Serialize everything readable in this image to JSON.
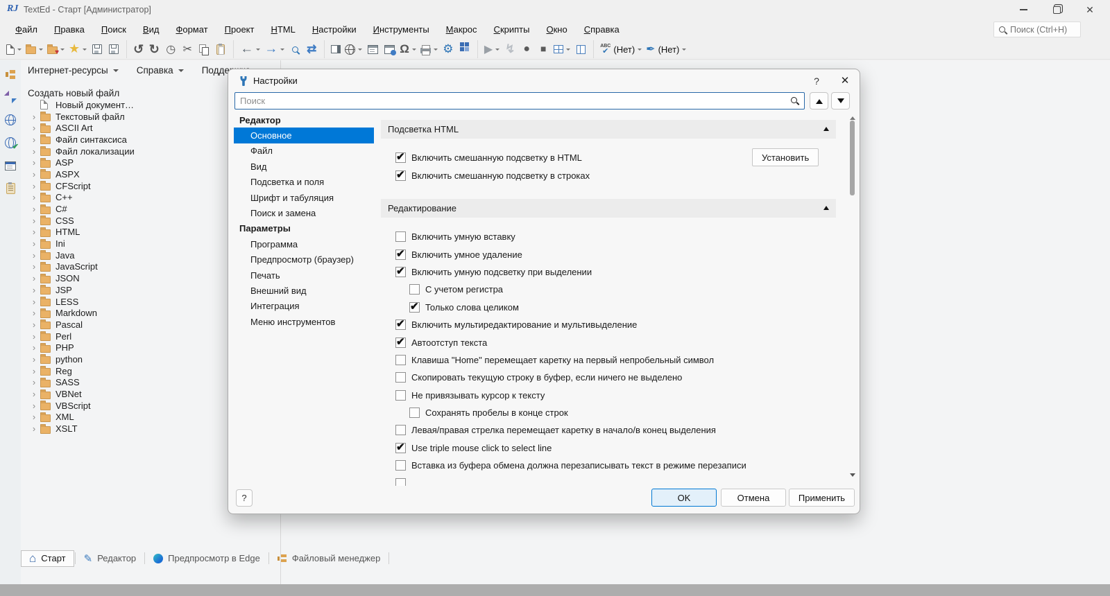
{
  "window": {
    "title": "TextEd - Старт [Администратор]"
  },
  "menubar": {
    "items": [
      "Файл",
      "Правка",
      "Поиск",
      "Вид",
      "Формат",
      "Проект",
      "HTML",
      "Настройки",
      "Инструменты",
      "Макрос",
      "Скрипты",
      "Окно",
      "Справка"
    ],
    "search_placeholder": "Поиск (Ctrl+H)"
  },
  "toolbar": {
    "items": [
      {
        "name": "new-file-icon",
        "icon": "i-new",
        "dd": true
      },
      {
        "name": "open-folder-icon",
        "icon": "i-folder",
        "dd": true
      },
      {
        "name": "favorites-folder-icon",
        "icon": "i-folder i-folder-heart",
        "dd": true
      },
      {
        "name": "star-icon",
        "icon": "i-star",
        "dd": true
      },
      {
        "name": "save-icon",
        "icon": "i-save"
      },
      {
        "name": "save-all-icon",
        "icon": "i-save"
      },
      {
        "name": "undo-icon",
        "icon": "i-undo",
        "sep": true
      },
      {
        "name": "redo-icon",
        "icon": "i-redo"
      },
      {
        "name": "history-icon",
        "icon": "i-history"
      },
      {
        "name": "cut-icon",
        "icon": "i-cut"
      },
      {
        "name": "copy-icon",
        "icon": "i-copy"
      },
      {
        "name": "paste-icon",
        "icon": "i-paste"
      },
      {
        "name": "back-icon",
        "icon": "i-back",
        "dd": true,
        "sep": true
      },
      {
        "name": "forward-icon",
        "icon": "i-forward",
        "dd": true
      },
      {
        "name": "search-icon",
        "icon": "i-mag i-search-blue"
      },
      {
        "name": "sync-icon",
        "icon": "i-sync"
      },
      {
        "name": "side-panel-icon",
        "icon": "i-panel",
        "sep": true
      },
      {
        "name": "globe-icon",
        "icon": "i-globe",
        "dd": true
      },
      {
        "name": "form-preview-icon",
        "icon": "i-form"
      },
      {
        "name": "browser-globe-icon",
        "icon": "i-browser-globe"
      },
      {
        "name": "omega-symbol-icon",
        "icon": "i-omega",
        "dd": true
      },
      {
        "name": "print-icon",
        "icon": "i-print",
        "dd": true
      },
      {
        "name": "settings-wrench-icon",
        "icon": "i-wrench"
      },
      {
        "name": "plugins-puzzle-icon",
        "icon": "i-puzzle"
      },
      {
        "name": "run-play-icon",
        "icon": "i-play",
        "dd": true,
        "sep": true
      },
      {
        "name": "quick-run-bolt-icon",
        "icon": "i-bolt"
      },
      {
        "name": "record-macro-icon",
        "icon": "i-record"
      },
      {
        "name": "stop-icon",
        "icon": "i-stop"
      },
      {
        "name": "layout-grid-icon",
        "icon": "i-grid",
        "dd": true
      },
      {
        "name": "columns-icon",
        "icon": "i-cols"
      },
      {
        "name": "spellcheck-abc-icon",
        "icon": "i-abc",
        "label": "(Нет)",
        "dd": true,
        "sep": true
      },
      {
        "name": "highlighter-brush-icon",
        "icon": "i-brush",
        "label": "(Нет)",
        "dd": true
      }
    ]
  },
  "rail": {
    "items": [
      {
        "name": "file-manager-tree-icon",
        "icon": "ri-tree"
      },
      {
        "name": "compare-arrows-icon",
        "icon": "ri-arrows"
      },
      {
        "name": "internet-globe-icon",
        "icon": "ri-globe"
      },
      {
        "name": "validate-globe-icon",
        "icon": "ri-globe-check"
      },
      {
        "name": "page-preview-icon",
        "icon": "ri-preview"
      },
      {
        "name": "clipboard-icon",
        "icon": "ri-clip"
      }
    ]
  },
  "sidebar": {
    "tabs": [
      {
        "label": "Интернет-ресурсы",
        "dropdown": true
      },
      {
        "label": "Справка",
        "dropdown": true
      },
      {
        "label": "Поддержка",
        "dropdown": false
      }
    ],
    "section_title": "Создать новый файл",
    "tree": [
      {
        "label": "Новый документ…",
        "icon": "i-doc",
        "no_expander": true
      },
      {
        "label": "Текстовый файл",
        "icon": "i-folder"
      },
      {
        "label": "ASCII Art",
        "icon": "i-folder"
      },
      {
        "label": "Файл синтаксиса",
        "icon": "i-folder"
      },
      {
        "label": "Файл локализации",
        "icon": "i-folder"
      },
      {
        "label": "ASP",
        "icon": "i-folder"
      },
      {
        "label": "ASPX",
        "icon": "i-folder"
      },
      {
        "label": "CFScript",
        "icon": "i-folder"
      },
      {
        "label": "C++",
        "icon": "i-folder"
      },
      {
        "label": "C#",
        "icon": "i-folder"
      },
      {
        "label": "CSS",
        "icon": "i-folder"
      },
      {
        "label": "HTML",
        "icon": "i-folder"
      },
      {
        "label": "Ini",
        "icon": "i-folder"
      },
      {
        "label": "Java",
        "icon": "i-folder"
      },
      {
        "label": "JavaScript",
        "icon": "i-folder"
      },
      {
        "label": "JSON",
        "icon": "i-folder"
      },
      {
        "label": "JSP",
        "icon": "i-folder"
      },
      {
        "label": "LESS",
        "icon": "i-folder"
      },
      {
        "label": "Markdown",
        "icon": "i-folder"
      },
      {
        "label": "Pascal",
        "icon": "i-folder"
      },
      {
        "label": "Perl",
        "icon": "i-folder"
      },
      {
        "label": "PHP",
        "icon": "i-folder"
      },
      {
        "label": "python",
        "icon": "i-folder"
      },
      {
        "label": "Reg",
        "icon": "i-folder"
      },
      {
        "label": "SASS",
        "icon": "i-folder"
      },
      {
        "label": "VBNet",
        "icon": "i-folder"
      },
      {
        "label": "VBScript",
        "icon": "i-folder"
      },
      {
        "label": "XML",
        "icon": "i-folder"
      },
      {
        "label": "XSLT",
        "icon": "i-folder"
      }
    ]
  },
  "dialog": {
    "title": "Настройки",
    "help_button": "?",
    "search_placeholder": "Поиск",
    "nav": [
      {
        "label": "Редактор",
        "group": true
      },
      {
        "label": "Основное",
        "selected": true
      },
      {
        "label": "Файл"
      },
      {
        "label": "Вид"
      },
      {
        "label": "Подсветка и поля"
      },
      {
        "label": "Шрифт и табуляция"
      },
      {
        "label": "Поиск и замена"
      },
      {
        "label": "Параметры",
        "group": true
      },
      {
        "label": "Программа"
      },
      {
        "label": "Предпросмотр (браузер)"
      },
      {
        "label": "Печать"
      },
      {
        "label": "Внешний вид"
      },
      {
        "label": "Интеграция"
      },
      {
        "label": "Меню инструментов"
      }
    ],
    "install_button": "Установить",
    "sections": [
      {
        "title": "Подсветка HTML",
        "items": [
          {
            "label": "Включить смешанную подсветку в HTML",
            "checked": true
          },
          {
            "label": "Включить смешанную подсветку в строках",
            "checked": true
          }
        ]
      },
      {
        "title": "Редактирование",
        "items": [
          {
            "label": "Включить умную вставку",
            "checked": false
          },
          {
            "label": "Включить умное удаление",
            "checked": true
          },
          {
            "label": "Включить умную подсветку при выделении",
            "checked": true
          },
          {
            "label": "С учетом регистра",
            "checked": false,
            "indent": true
          },
          {
            "label": "Только слова целиком",
            "checked": true,
            "indent": true
          },
          {
            "label": "Включить мультиредактирование и мультивыделение",
            "checked": true
          },
          {
            "label": "Автоотступ текста",
            "checked": true
          },
          {
            "label": "Клавиша \"Home\" перемещает каретку на первый непробельный символ",
            "checked": false
          },
          {
            "label": "Скопировать текущую строку в буфер, если ничего не выделено",
            "checked": false
          },
          {
            "label": "Не привязывать курсор к тексту",
            "checked": false
          },
          {
            "label": "Сохранять пробелы в конце строк",
            "checked": false,
            "indent": true
          },
          {
            "label": "Левая/правая стрелка перемещает каретку в начало/в конец выделения",
            "checked": false
          },
          {
            "label": "Use triple mouse click to select line",
            "checked": true
          },
          {
            "label": "Вставка из буфера обмена должна перезаписывать текст в режиме перезаписи",
            "checked": false
          },
          {
            "label": "",
            "checked": false,
            "partial": true
          }
        ]
      }
    ],
    "footer": {
      "help": "?",
      "ok": "OK",
      "cancel": "Отмена",
      "apply": "Применить"
    }
  },
  "statusbar": {
    "tabs": [
      {
        "label": "Старт",
        "icon": "ti-home",
        "active": true
      },
      {
        "label": "Редактор",
        "icon": "ti-pencil"
      },
      {
        "label": "Предпросмотр в Edge",
        "icon": "ti-edge"
      },
      {
        "label": "Файловый менеджер",
        "icon": "ti-tree"
      }
    ]
  },
  "colors": {
    "accent": "#0078d7",
    "folder": "#eab266",
    "star": "#e8b93d"
  }
}
